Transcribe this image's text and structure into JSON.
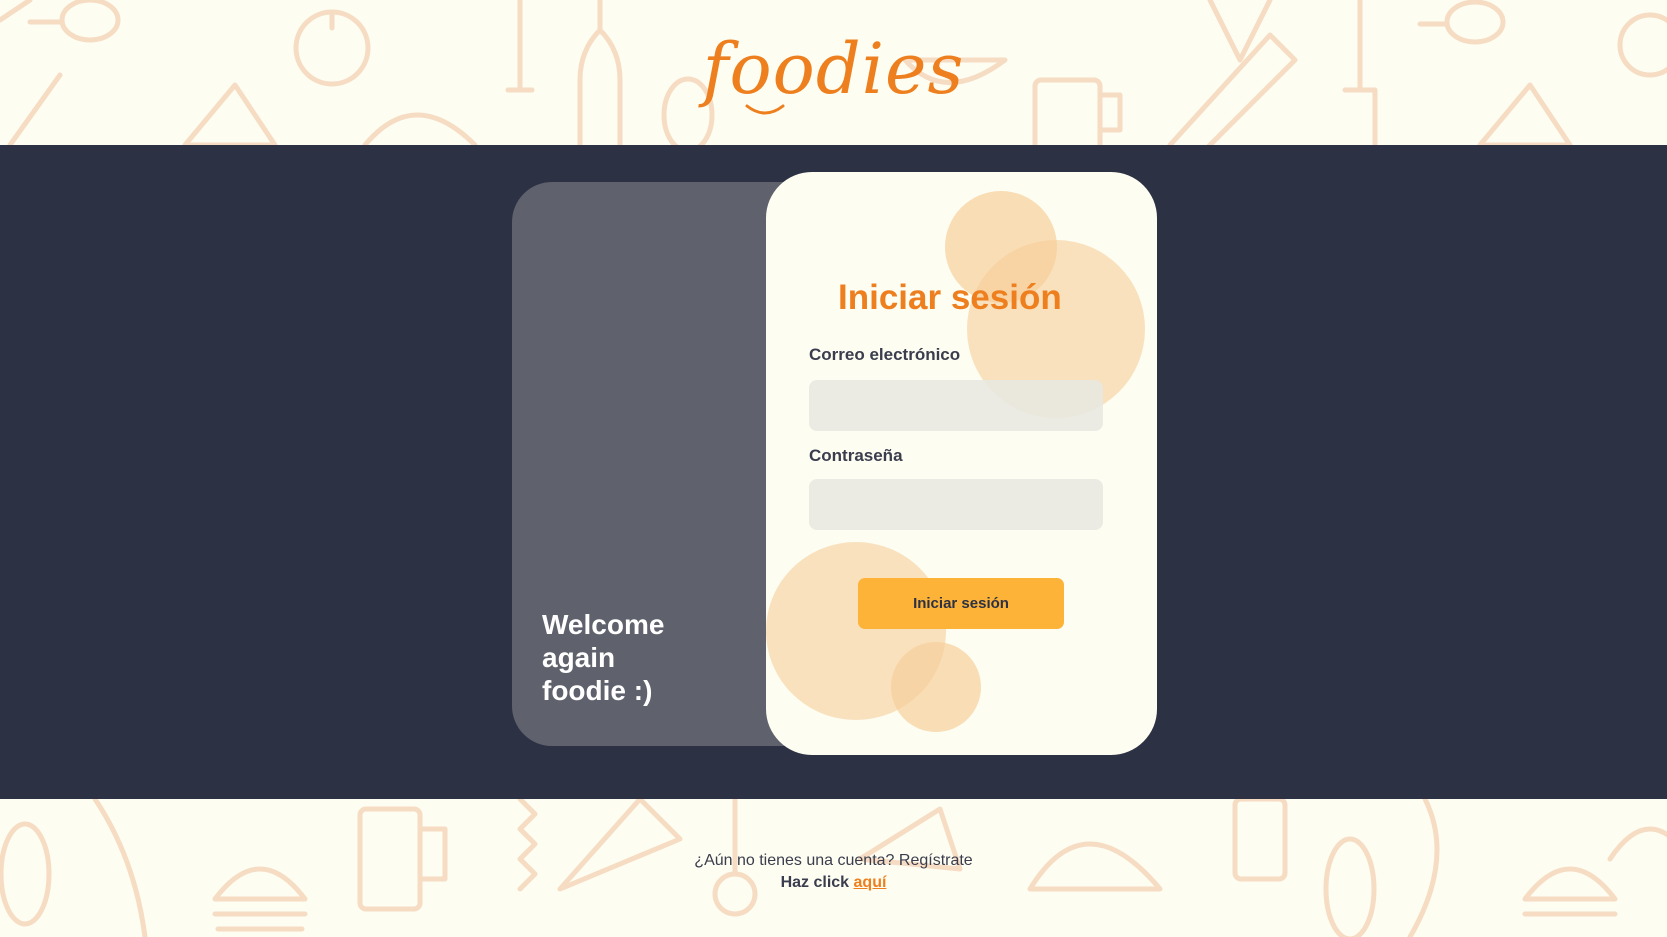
{
  "brand": {
    "logo_text": "foodies",
    "accent_color": "#ee7f1f",
    "band_color": "#2d3144"
  },
  "side_panel": {
    "welcome_line1": "Welcome",
    "welcome_line2": "again",
    "welcome_line3": "foodie :)"
  },
  "login": {
    "title": "Iniciar sesión",
    "email_label": "Correo electrónico",
    "email_value": "",
    "password_label": "Contraseña",
    "password_value": "",
    "submit_label": "Iniciar sesión",
    "button_color": "#fdb338"
  },
  "footer": {
    "prompt": "¿Aún no tienes una cuenta? Regístrate",
    "click_text": "Haz click",
    "link_text": "aquí"
  },
  "background_pattern_icons": [
    "spoon-icon",
    "orange-icon",
    "bottle-icon",
    "pizza-icon",
    "burger-icon",
    "taco-icon",
    "beer-mug-icon",
    "corn-icon",
    "knife-icon",
    "ice-cream-icon"
  ]
}
